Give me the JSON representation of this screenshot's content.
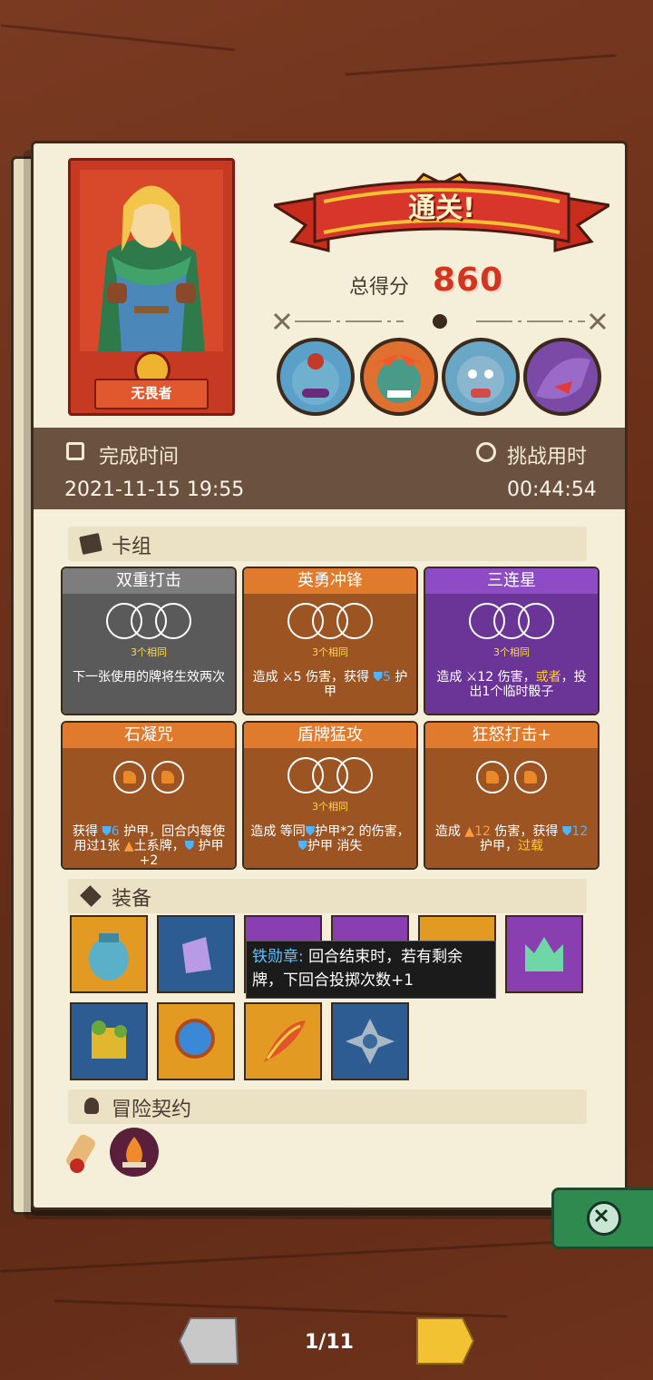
{
  "hero": {
    "name": "无畏者"
  },
  "result": {
    "banner": "通关!",
    "score_label": "总得分",
    "score": "860"
  },
  "time": {
    "finish_label": "完成时间",
    "finish_value": "2021-11-15 19:55",
    "duration_label": "挑战用时",
    "duration_value": "00:44:54"
  },
  "deck": {
    "title": "卡组",
    "cards": [
      {
        "name": "双重打击",
        "tag": "3个相同",
        "desc": "下一张使用的牌将生效两次",
        "color": "gray"
      },
      {
        "name": "英勇冲锋",
        "tag": "3个相同",
        "desc_pre": "造成 ",
        "desc_a": "5",
        "desc_mid": " 伤害，获得 ",
        "desc_b": "5",
        "desc_post": " 护甲",
        "color": "orange"
      },
      {
        "name": "三连星",
        "tag": "3个相同",
        "desc_pre": "造成 ",
        "desc_a": "12",
        "desc_mid": " 伤害，",
        "desc_b": "或者",
        "desc_post": "，投出1个临时骰子",
        "color": "purple"
      },
      {
        "name": "石凝咒",
        "desc_pre": "获得 ",
        "desc_a": "6",
        "desc_mid": " 护甲，回合内每使用过1张 ",
        "desc_b": "土系牌，",
        "desc_post": " 护甲+2",
        "color": "orange"
      },
      {
        "name": "盾牌猛攻",
        "tag": "3个相同",
        "desc_pre": "造成 等同",
        "desc_a": "护甲*2 的伤害，",
        "desc_post": "护甲 消失",
        "color": "orange"
      },
      {
        "name": "狂怒打击+",
        "desc_pre": "造成 ",
        "desc_a": "12",
        "desc_mid": " 伤害，获得 ",
        "desc_b": "12",
        "desc_mid2": " 护甲，",
        "desc_c": "过载",
        "color": "orange"
      }
    ]
  },
  "equipment": {
    "title": "装备",
    "tooltip_name": "铁勋章:",
    "tooltip_text": " 回合结束时，若有剩余牌，下回合投掷次数+1"
  },
  "contract": {
    "title": "冒险契约"
  },
  "pager": {
    "current": "1/11"
  }
}
